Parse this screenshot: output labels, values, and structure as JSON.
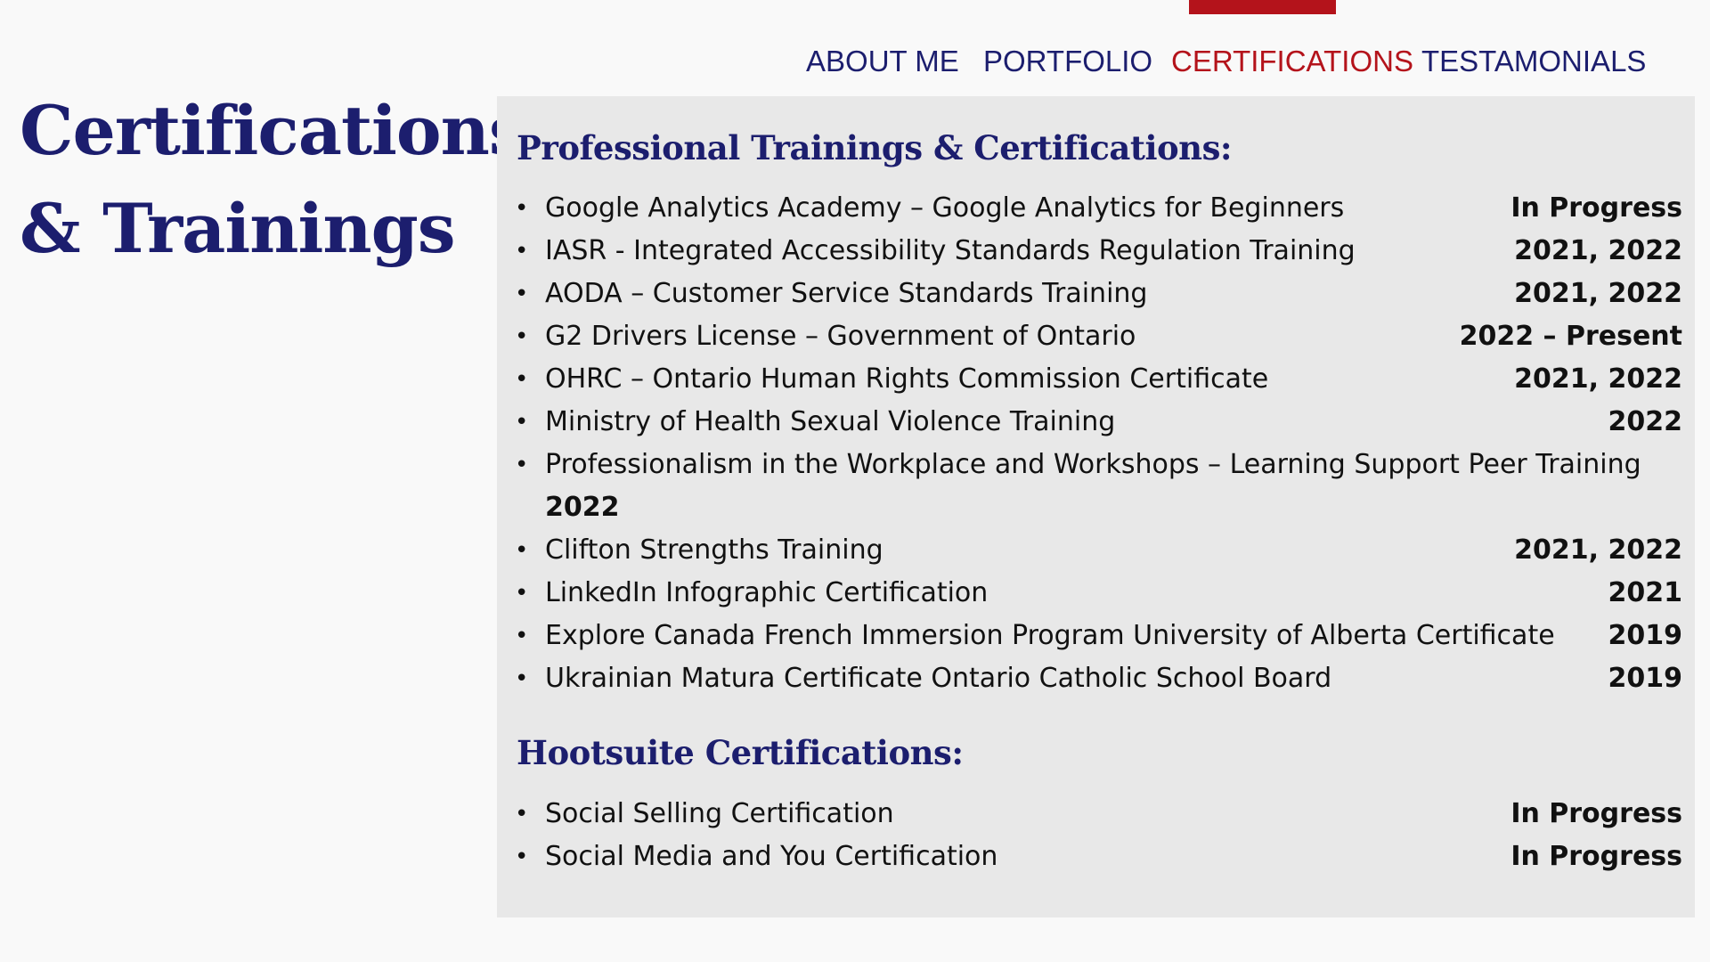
{
  "nav": {
    "items": [
      {
        "label": "ABOUT ME",
        "active": false
      },
      {
        "label": "PORTFOLIO",
        "active": false
      },
      {
        "label": "CERTIFICATIONS",
        "active": true
      },
      {
        "label": "TESTAMONIALS",
        "active": false
      }
    ]
  },
  "title": {
    "line1": "Certifications",
    "line2": "& Trainings"
  },
  "professional": {
    "heading": "Professional Trainings & Certifications:",
    "items": [
      {
        "text": "Google Analytics Academy – Google Analytics for Beginners",
        "date": "In Progress"
      },
      {
        "text": "IASR - Integrated Accessibility Standards Regulation Training",
        "date": "2021, 2022"
      },
      {
        "text": "AODA – Customer Service Standards Training",
        "date": "2021, 2022"
      },
      {
        "text": "G2 Drivers License – Government of Ontario",
        "date": "2022 – Present"
      },
      {
        "text": "OHRC – Ontario Human Rights Commission Certificate",
        "date": "2021, 2022"
      },
      {
        "text": "Ministry of Health Sexual Violence Training",
        "date": "2022"
      },
      {
        "text": "Professionalism in the Workplace and Workshops – Learning Support Peer Training",
        "date": "2022"
      },
      {
        "text": "Clifton Strengths Training",
        "date": "2021, 2022"
      },
      {
        "text": "LinkedIn Infographic Certification",
        "date": "2021"
      },
      {
        "text": "Explore Canada French Immersion Program University of Alberta Certificate",
        "date": "2019"
      },
      {
        "text": "Ukrainian Matura Certificate Ontario Catholic School Board",
        "date": "2019"
      }
    ]
  },
  "hootsuite": {
    "heading": "Hootsuite Certifications:",
    "items": [
      {
        "text": "Social Selling Certification",
        "date": "In Progress"
      },
      {
        "text": "Social Media and You Certification",
        "date": "In Progress"
      }
    ]
  },
  "colors": {
    "brand_navy": "#1c1e6e",
    "accent_red": "#b4131b",
    "panel_bg": "#e8e8e8",
    "page_bg": "#f9f9f9"
  }
}
